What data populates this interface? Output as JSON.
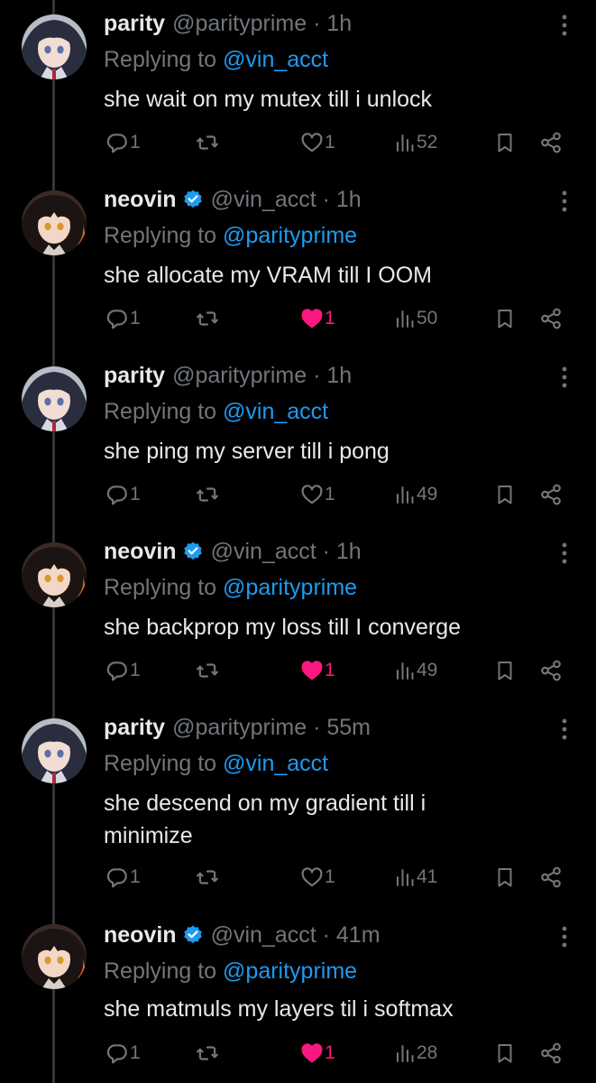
{
  "tweets": [
    {
      "id": "t1",
      "author": "parity",
      "handle": "@parityprime",
      "time": "1h",
      "verified": false,
      "avatar": "parity",
      "replying_prefix": "Replying to ",
      "replying_to": "@vin_acct",
      "text": "she wait on my mutex till i unlock",
      "replies": "1",
      "likes": "1",
      "liked": false,
      "views": "52"
    },
    {
      "id": "t2",
      "author": "neovin",
      "handle": "@vin_acct",
      "time": "1h",
      "verified": true,
      "avatar": "neovin",
      "replying_prefix": "Replying to ",
      "replying_to": "@parityprime",
      "text": "she allocate my VRAM till I OOM",
      "replies": "1",
      "likes": "1",
      "liked": true,
      "views": "50"
    },
    {
      "id": "t3",
      "author": "parity",
      "handle": "@parityprime",
      "time": "1h",
      "verified": false,
      "avatar": "parity",
      "replying_prefix": "Replying to ",
      "replying_to": "@vin_acct",
      "text": "she ping my server till i pong",
      "replies": "1",
      "likes": "1",
      "liked": false,
      "views": "49"
    },
    {
      "id": "t4",
      "author": "neovin",
      "handle": "@vin_acct",
      "time": "1h",
      "verified": true,
      "avatar": "neovin",
      "replying_prefix": "Replying to ",
      "replying_to": "@parityprime",
      "text": "she backprop my loss till I converge",
      "replies": "1",
      "likes": "1",
      "liked": true,
      "views": "49"
    },
    {
      "id": "t5",
      "author": "parity",
      "handle": "@parityprime",
      "time": "55m",
      "verified": false,
      "avatar": "parity",
      "replying_prefix": "Replying to ",
      "replying_to": "@vin_acct",
      "text": "she descend on my gradient till i minimize",
      "replies": "1",
      "likes": "1",
      "liked": false,
      "views": "41"
    },
    {
      "id": "t6",
      "author": "neovin",
      "handle": "@vin_acct",
      "time": "41m",
      "verified": true,
      "avatar": "neovin",
      "replying_prefix": "Replying to ",
      "replying_to": "@parityprime",
      "text": "she matmuls my layers til i softmax",
      "replies": "1",
      "likes": "1",
      "liked": true,
      "views": "28"
    }
  ],
  "colors": {
    "background": "#000000",
    "text": "#e7e9ea",
    "muted": "#71767b",
    "link": "#1d9bf0",
    "like": "#f91880",
    "thread_line": "#333639"
  },
  "icons": [
    "reply-icon",
    "retweet-icon",
    "heart-icon",
    "views-icon",
    "bookmark-icon",
    "share-icon",
    "more-icon",
    "verified-badge-icon"
  ]
}
